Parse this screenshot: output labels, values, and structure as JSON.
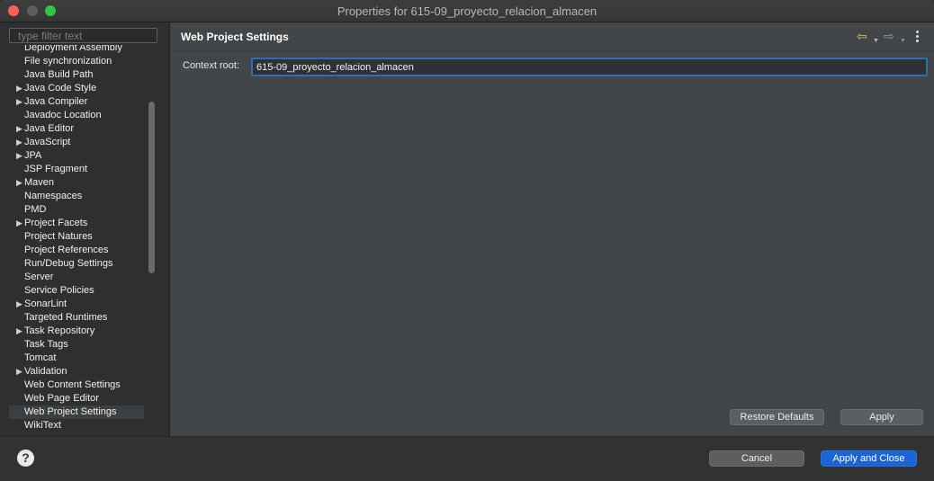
{
  "window": {
    "title": "Properties for 615-09_proyecto_relacion_almacen"
  },
  "sidebar": {
    "filter_placeholder": "type filter text",
    "items": [
      {
        "label": "Deployment Assembly",
        "expandable": false
      },
      {
        "label": "File synchronization",
        "expandable": false
      },
      {
        "label": "Java Build Path",
        "expandable": false
      },
      {
        "label": "Java Code Style",
        "expandable": true
      },
      {
        "label": "Java Compiler",
        "expandable": true
      },
      {
        "label": "Javadoc Location",
        "expandable": false
      },
      {
        "label": "Java Editor",
        "expandable": true
      },
      {
        "label": "JavaScript",
        "expandable": true
      },
      {
        "label": "JPA",
        "expandable": true
      },
      {
        "label": "JSP Fragment",
        "expandable": false
      },
      {
        "label": "Maven",
        "expandable": true
      },
      {
        "label": "Namespaces",
        "expandable": false
      },
      {
        "label": "PMD",
        "expandable": false
      },
      {
        "label": "Project Facets",
        "expandable": true
      },
      {
        "label": "Project Natures",
        "expandable": false
      },
      {
        "label": "Project References",
        "expandable": false
      },
      {
        "label": "Run/Debug Settings",
        "expandable": false
      },
      {
        "label": "Server",
        "expandable": false
      },
      {
        "label": "Service Policies",
        "expandable": false
      },
      {
        "label": "SonarLint",
        "expandable": true
      },
      {
        "label": "Targeted Runtimes",
        "expandable": false
      },
      {
        "label": "Task Repository",
        "expandable": true
      },
      {
        "label": "Task Tags",
        "expandable": false
      },
      {
        "label": "Tomcat",
        "expandable": false
      },
      {
        "label": "Validation",
        "expandable": true
      },
      {
        "label": "Web Content Settings",
        "expandable": false
      },
      {
        "label": "Web Page Editor",
        "expandable": false
      },
      {
        "label": "Web Project Settings",
        "expandable": false,
        "selected": true
      },
      {
        "label": "WikiText",
        "expandable": false
      }
    ]
  },
  "main": {
    "title": "Web Project Settings",
    "context_root_label": "Context root:",
    "context_root_value": "615-09_proyecto_relacion_almacen",
    "restore_defaults_label": "Restore Defaults",
    "apply_label": "Apply"
  },
  "footer": {
    "cancel_label": "Cancel",
    "apply_close_label": "Apply and Close"
  },
  "colors": {
    "accent": "#1a64d6",
    "focus_border": "#2f6eb3",
    "back_arrow": "#e8c24a"
  }
}
